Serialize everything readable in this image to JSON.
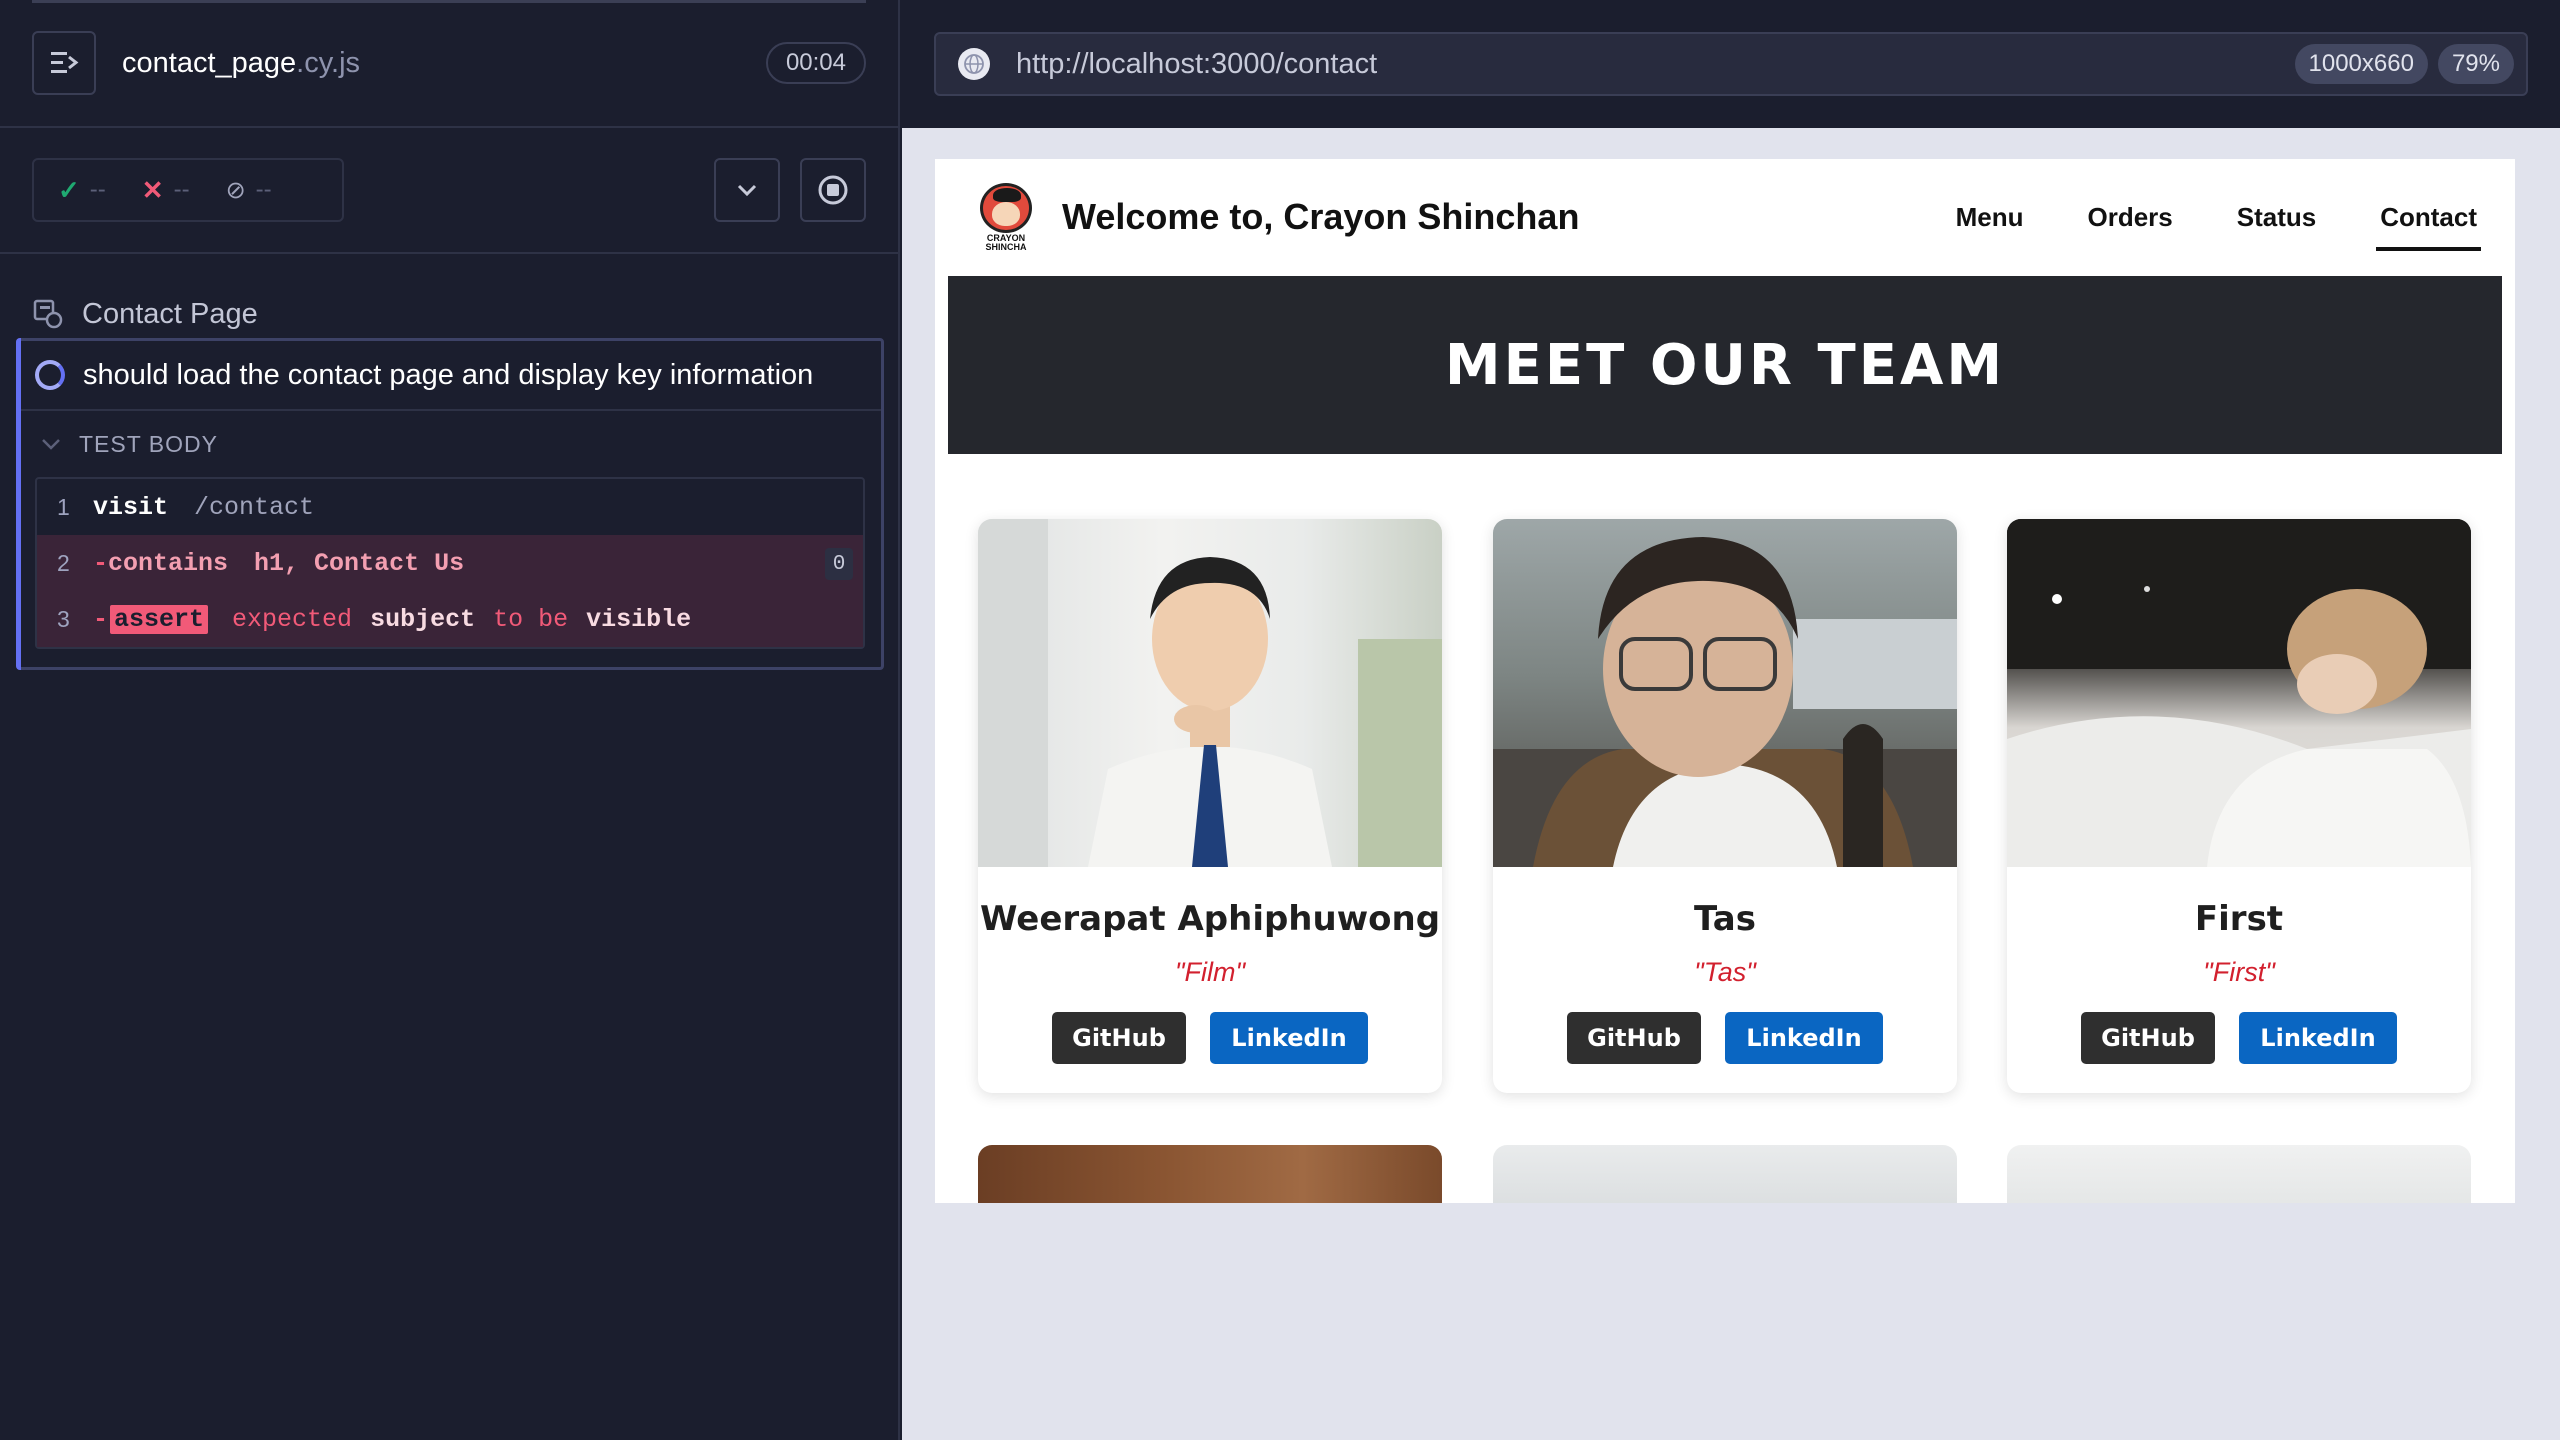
{
  "reporter": {
    "spec_file": "contact_page",
    "spec_ext": ".cy.js",
    "duration": "00:04",
    "stats": {
      "passed": "--",
      "failed": "--",
      "pending": "--"
    },
    "suite_title": "Contact Page",
    "test_title": "should load the contact page and display key information",
    "body_label": "TEST BODY",
    "commands": [
      {
        "num": "1",
        "name": "visit",
        "message": "/contact"
      },
      {
        "num": "2",
        "name": "contains",
        "message": "h1, Contact Us",
        "badge": "0"
      },
      {
        "num": "3",
        "name": "assert",
        "tokens": [
          "expected",
          "subject",
          "to be",
          "visible"
        ]
      }
    ]
  },
  "aut": {
    "url": "http://localhost:3000/contact",
    "viewport_size": "1000x660",
    "zoom": "79%"
  },
  "site": {
    "logo_text_1": "CRAYON",
    "logo_text_2": "SHINCHA",
    "brand": "Welcome to, Crayon Shinchan",
    "nav": [
      "Menu",
      "Orders",
      "Status",
      "Contact"
    ],
    "active_nav": "Contact",
    "hero_title": "MEET OUR TEAM",
    "team": [
      {
        "name": "Weerapat Aphiphuwong",
        "nickname": "\"Film\"",
        "github": "GitHub",
        "linkedin": "LinkedIn"
      },
      {
        "name": "Tas",
        "nickname": "\"Tas\"",
        "github": "GitHub",
        "linkedin": "LinkedIn"
      },
      {
        "name": "First",
        "nickname": "\"First\"",
        "github": "GitHub",
        "linkedin": "LinkedIn"
      }
    ]
  },
  "colors": {
    "reporter_bg": "#1b1e2e",
    "fail": "#f15a78",
    "pass": "#1fa971",
    "accent": "#6470f3",
    "hero_bg": "#25272d",
    "nickname": "#d2202e",
    "github_btn": "#2f2f2f",
    "linkedin_btn": "#0a66c2"
  }
}
